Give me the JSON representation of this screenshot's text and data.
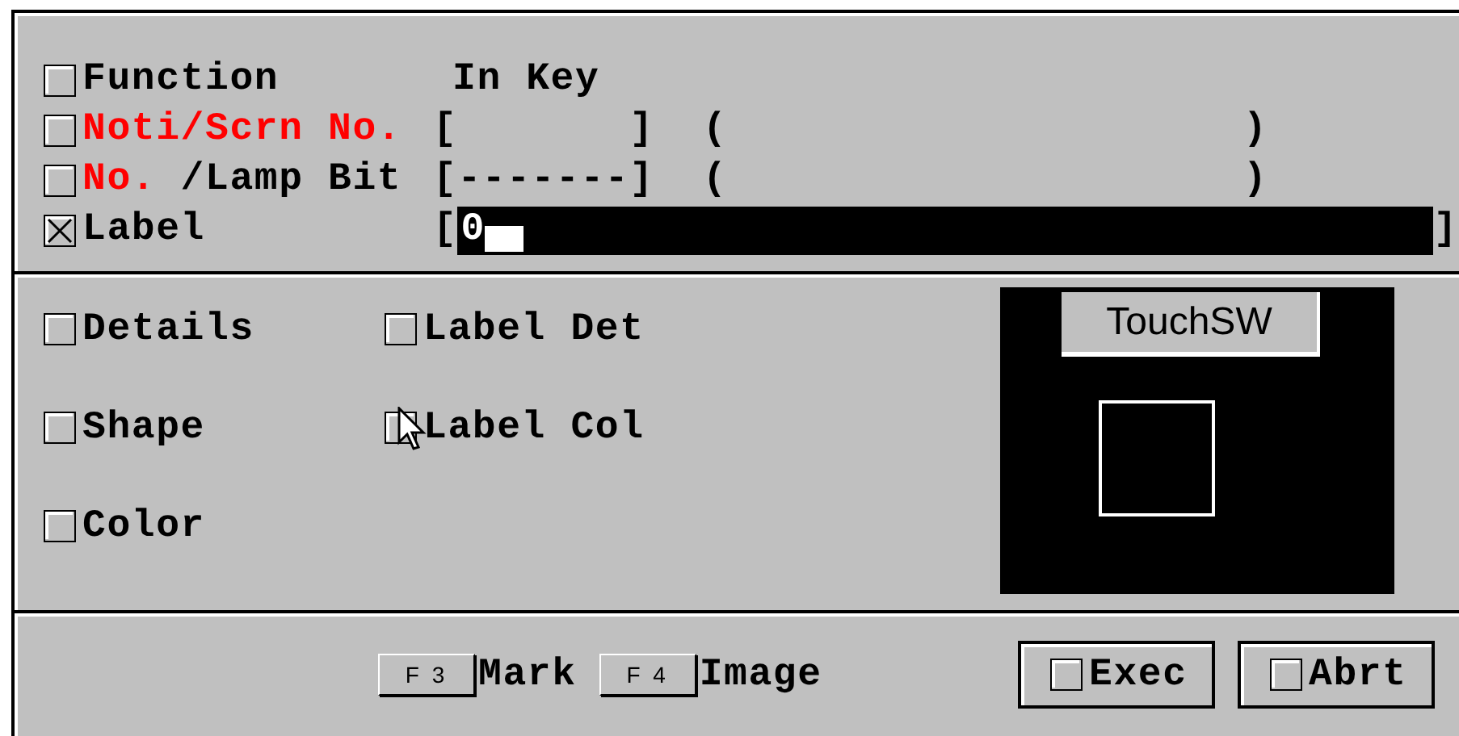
{
  "top_rows": [
    {
      "kind": "text",
      "checked": false,
      "label_parts": [
        {
          "text": "Function",
          "alert": false
        }
      ],
      "value": "In Key"
    },
    {
      "kind": "code",
      "checked": false,
      "label_parts": [
        {
          "text": "Noti/Scrn No.",
          "alert": true
        }
      ],
      "code": "[       ]",
      "comment": "(                     )"
    },
    {
      "kind": "code",
      "checked": false,
      "label_parts": [
        {
          "text": "No.",
          "alert": true
        },
        {
          "text": " /Lamp Bit",
          "alert": false
        }
      ],
      "code": "[-------]",
      "comment": "(                     )"
    },
    {
      "kind": "input",
      "checked": true,
      "label_parts": [
        {
          "text": "Label",
          "alert": false
        }
      ],
      "open": "[",
      "value": "0",
      "close": "]"
    }
  ],
  "options": [
    {
      "label": "Details",
      "checked": false
    },
    {
      "label": "Label Det",
      "checked": false
    },
    {
      "label": "Shape",
      "checked": false
    },
    {
      "label": "Label Col",
      "checked": false
    },
    {
      "label": "Color",
      "checked": false
    }
  ],
  "preview": {
    "caption": "TouchSW"
  },
  "footer": {
    "keys": [
      {
        "key": "F 3",
        "label": "Mark"
      },
      {
        "key": "F 4",
        "label": "Image"
      }
    ],
    "buttons": [
      {
        "label": "Exec",
        "checked": false
      },
      {
        "label": "Abrt",
        "checked": false
      }
    ]
  }
}
